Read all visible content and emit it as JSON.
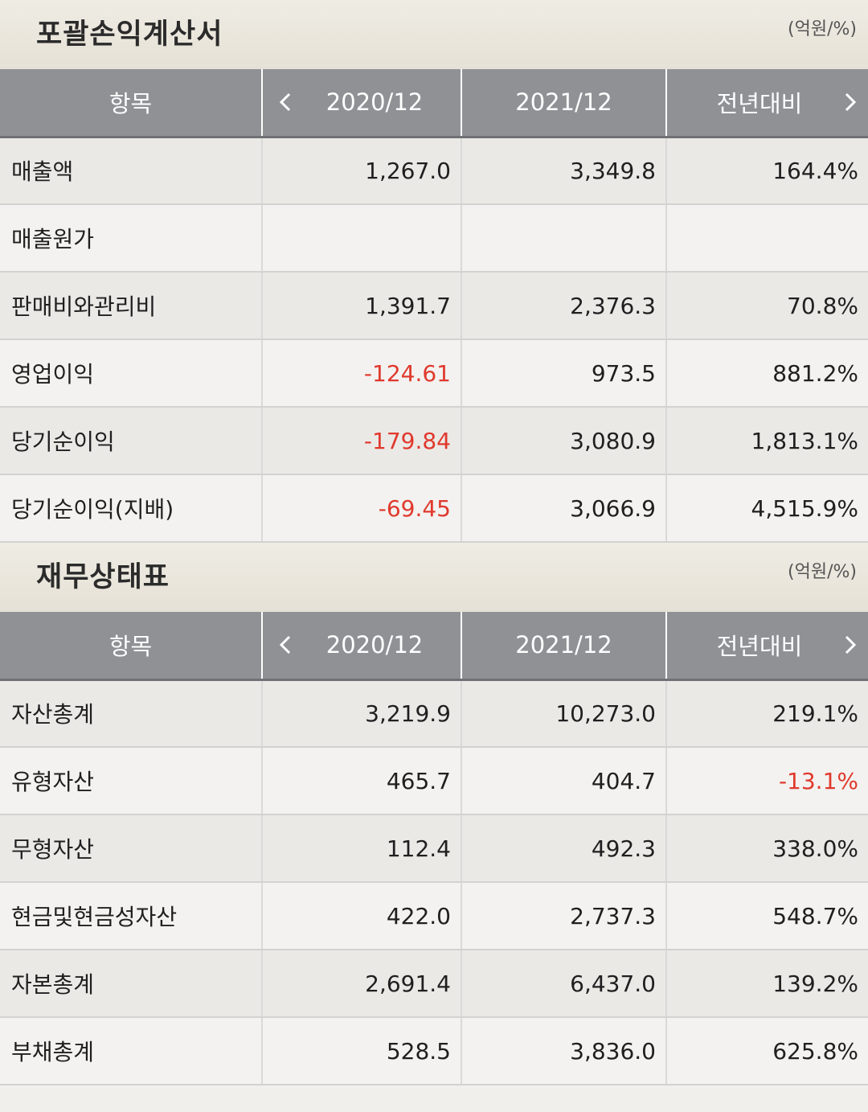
{
  "income": {
    "title": "포괄손익계산서",
    "unit": "(억원/%)",
    "columns": [
      "항목",
      "2020/12",
      "2021/12",
      "전년대비"
    ],
    "rows": [
      {
        "label": "매출액",
        "y2020": "1,267.0",
        "y2021": "3,349.8",
        "yoy": "164.4%"
      },
      {
        "label": "매출원가",
        "y2020": "",
        "y2021": "",
        "yoy": ""
      },
      {
        "label": "판매비와관리비",
        "y2020": "1,391.7",
        "y2021": "2,376.3",
        "yoy": "70.8%"
      },
      {
        "label": "영업이익",
        "y2020": "-124.61",
        "y2021": "973.5",
        "yoy": "881.2%"
      },
      {
        "label": "당기순이익",
        "y2020": "-179.84",
        "y2021": "3,080.9",
        "yoy": "1,813.1%"
      },
      {
        "label": "당기순이익(지배)",
        "y2020": "-69.45",
        "y2021": "3,066.9",
        "yoy": "4,515.9%"
      }
    ]
  },
  "balance": {
    "title": "재무상태표",
    "unit": "(억원/%)",
    "columns": [
      "항목",
      "2020/12",
      "2021/12",
      "전년대비"
    ],
    "rows": [
      {
        "label": "자산총계",
        "y2020": "3,219.9",
        "y2021": "10,273.0",
        "yoy": "219.1%"
      },
      {
        "label": "유형자산",
        "y2020": "465.7",
        "y2021": "404.7",
        "yoy": "-13.1%"
      },
      {
        "label": "무형자산",
        "y2020": "112.4",
        "y2021": "492.3",
        "yoy": "338.0%"
      },
      {
        "label": "현금및현금성자산",
        "y2020": "422.0",
        "y2021": "2,737.3",
        "yoy": "548.7%"
      },
      {
        "label": "자본총계",
        "y2020": "2,691.4",
        "y2021": "6,437.0",
        "yoy": "139.2%"
      },
      {
        "label": "부채총계",
        "y2020": "528.5",
        "y2021": "3,836.0",
        "yoy": "625.8%"
      }
    ]
  },
  "colors": {
    "header_bg": "#8f9195",
    "negative": "#e0392d"
  },
  "icons": {
    "prev": "chevron-left-icon",
    "next": "chevron-right-icon"
  }
}
